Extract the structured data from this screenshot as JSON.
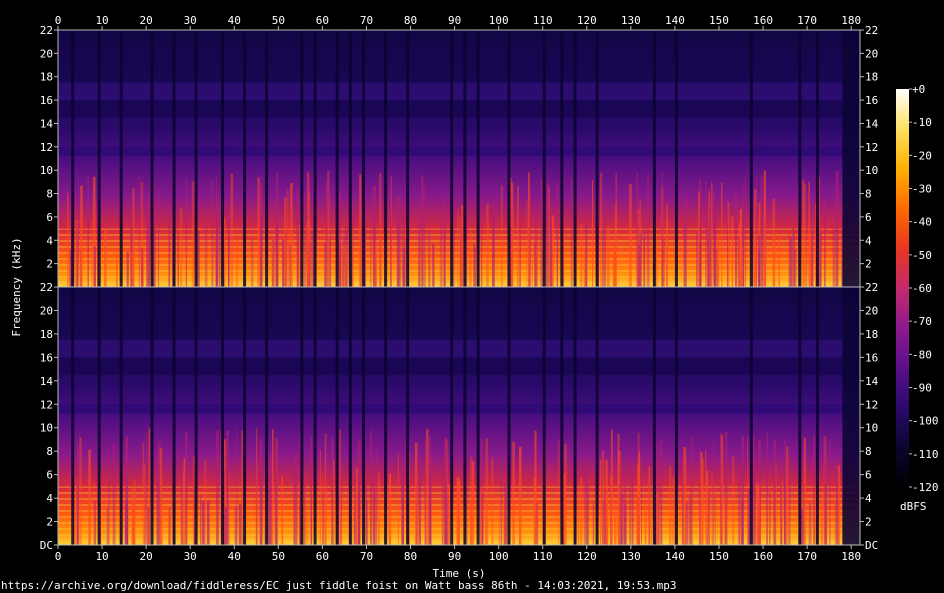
{
  "chart_data": {
    "type": "heatmap",
    "title": "",
    "xlabel": "Time (s)",
    "ylabel": "Frequency (kHz)",
    "xlim": [
      0,
      182
    ],
    "ylim": [
      0,
      22
    ],
    "x_ticks": [
      "0",
      "10",
      "20",
      "30",
      "40",
      "50",
      "60",
      "70",
      "80",
      "90",
      "100",
      "110",
      "120",
      "130",
      "140",
      "150",
      "160",
      "170",
      "180"
    ],
    "y_ticks": [
      "DC",
      "2",
      "4",
      "6",
      "8",
      "10",
      "12",
      "14",
      "16",
      "18",
      "20",
      "22"
    ],
    "channels": 2,
    "colorbar": {
      "label": "dBFS",
      "range": [
        -120,
        0
      ],
      "ticks": [
        "+0",
        "-10",
        "-20",
        "-30",
        "-40",
        "-50",
        "-60",
        "-70",
        "-80",
        "-90",
        "-100",
        "-110",
        "-120"
      ]
    },
    "colormap": [
      "#000000",
      "#0b0530",
      "#2a0a6b",
      "#5b0f8a",
      "#8e1a8e",
      "#c42a6b",
      "#e8361f",
      "#ff6a00",
      "#ffb000",
      "#ffe060",
      "#ffffff"
    ],
    "silent_gaps_s": [
      3,
      9,
      14,
      21,
      26,
      31,
      37,
      42,
      47,
      55,
      58,
      63,
      66,
      69,
      74,
      79,
      89,
      92,
      95,
      102,
      110,
      114,
      117,
      122,
      135,
      140,
      157,
      168,
      172
    ],
    "band_edges_khz": [
      12,
      14.5,
      16,
      17.5,
      18,
      20.5
    ]
  },
  "footer": {
    "source": "https://archive.org/download/fiddleress/EC just fiddle foist on Watt bass 86th  - 14:03:2021, 19:53.mp3"
  }
}
